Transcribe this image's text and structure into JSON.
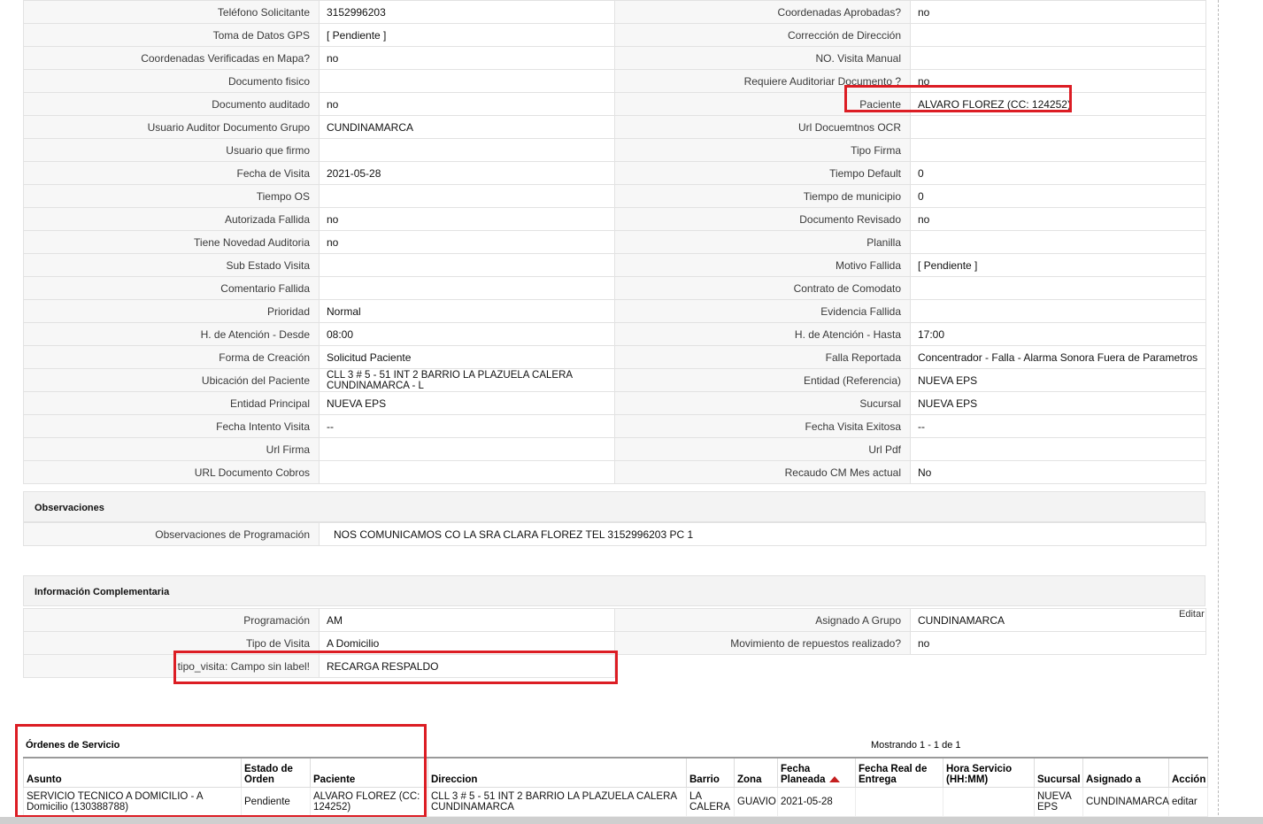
{
  "detail_rows": [
    [
      {
        "label": "Teléfono Solicitante",
        "value": "3152996203"
      },
      {
        "label": "Coordenadas Aprobadas?",
        "value": "no"
      }
    ],
    [
      {
        "label": "Toma de Datos GPS",
        "value": "[ Pendiente ]"
      },
      {
        "label": "Corrección de Dirección",
        "value": ""
      }
    ],
    [
      {
        "label": "Coordenadas Verificadas en Mapa?",
        "value": "no"
      },
      {
        "label": "NO. Visita Manual",
        "value": ""
      }
    ],
    [
      {
        "label": "Documento fisico",
        "value": ""
      },
      {
        "label": "Requiere Auditoriar Documento ?",
        "value": "no"
      }
    ],
    [
      {
        "label": "Documento auditado",
        "value": "no"
      },
      {
        "label": "Paciente",
        "value": "ALVARO FLOREZ (CC: 124252)"
      }
    ],
    [
      {
        "label": "Usuario Auditor Documento Grupo",
        "value": "CUNDINAMARCA"
      },
      {
        "label": "Url Docuemtnos OCR",
        "value": ""
      }
    ],
    [
      {
        "label": "Usuario que firmo",
        "value": ""
      },
      {
        "label": "Tipo Firma",
        "value": ""
      }
    ],
    [
      {
        "label": "Fecha de Visita",
        "value": "2021-05-28"
      },
      {
        "label": "Tiempo Default",
        "value": "0"
      }
    ],
    [
      {
        "label": "Tiempo OS",
        "value": ""
      },
      {
        "label": "Tiempo de municipio",
        "value": "0"
      }
    ],
    [
      {
        "label": "Autorizada Fallida",
        "value": "no"
      },
      {
        "label": "Documento Revisado",
        "value": "no"
      }
    ],
    [
      {
        "label": "Tiene Novedad Auditoria",
        "value": "no"
      },
      {
        "label": "Planilla",
        "value": ""
      }
    ],
    [
      {
        "label": "Sub Estado Visita",
        "value": ""
      },
      {
        "label": "Motivo Fallida",
        "value": "[ Pendiente ]"
      }
    ],
    [
      {
        "label": "Comentario Fallida",
        "value": ""
      },
      {
        "label": "Contrato de Comodato",
        "value": ""
      }
    ],
    [
      {
        "label": "Prioridad",
        "value": "Normal"
      },
      {
        "label": "Evidencia Fallida",
        "value": ""
      }
    ],
    [
      {
        "label": "H. de Atención - Desde",
        "value": "08:00"
      },
      {
        "label": "H. de Atención - Hasta",
        "value": "17:00"
      }
    ],
    [
      {
        "label": "Forma de Creación",
        "value": "Solicitud Paciente"
      },
      {
        "label": "Falla Reportada",
        "value": "Concentrador - Falla - Alarma Sonora Fuera de Parametros"
      }
    ],
    [
      {
        "label": "Ubicación del Paciente",
        "value": "CLL 3 # 5 - 51 INT 2 BARRIO LA PLAZUELA CALERA CUNDINAMARCA - L"
      },
      {
        "label": "Entidad (Referencia)",
        "value": "NUEVA EPS"
      }
    ],
    [
      {
        "label": "Entidad Principal",
        "value": "NUEVA EPS"
      },
      {
        "label": "Sucursal",
        "value": "NUEVA EPS"
      }
    ],
    [
      {
        "label": "Fecha Intento Visita",
        "value": "--"
      },
      {
        "label": "Fecha Visita Exitosa",
        "value": "--"
      }
    ],
    [
      {
        "label": "Url Firma",
        "value": ""
      },
      {
        "label": "Url Pdf",
        "value": ""
      }
    ],
    [
      {
        "label": "URL Documento Cobros",
        "value": ""
      },
      {
        "label": "Recaudo CM Mes actual",
        "value": "No"
      }
    ]
  ],
  "observaciones": {
    "title": "Observaciones",
    "label": "Observaciones de Programación",
    "value": "NOS COMUNICAMOS CO LA SRA CLARA FLOREZ TEL 3152996203 PC 1"
  },
  "info_complementaria": {
    "title": "Información Complementaria",
    "edit_label": "Editar",
    "rows": [
      [
        {
          "label": "Programación",
          "value": "AM"
        },
        {
          "label": "Asignado A Grupo",
          "value": "CUNDINAMARCA"
        }
      ],
      [
        {
          "label": "Tipo de Visita",
          "value": "A Domicilio"
        },
        {
          "label": "Movimiento de repuestos realizado?",
          "value": "no"
        }
      ],
      [
        {
          "label": "tipo_visita: Campo sin label!",
          "value": "RECARGA RESPALDO"
        }
      ]
    ]
  },
  "ordenes": {
    "title": "Órdenes de Servicio",
    "showing": "Mostrando 1 - 1 de 1",
    "columns": [
      "Asunto",
      "Estado de Orden",
      "Paciente",
      "Direccion",
      "Barrio",
      "Zona",
      "Fecha Planeada",
      "Fecha Real de Entrega",
      "Hora Servicio (HH:MM)",
      "Sucursal",
      "Asignado a",
      "Acción"
    ],
    "rows": [
      [
        "SERVICIO TECNICO A DOMICILIO - A Domicilio (130388788)",
        "Pendiente",
        "ALVARO FLOREZ (CC: 124252)",
        "CLL 3 # 5 - 51 INT 2 BARRIO LA PLAZUELA CALERA CUNDINAMARCA",
        "LA CALERA",
        "GUAVIO",
        "2021-05-28",
        "",
        "",
        "NUEVA EPS",
        "CUNDINAMARCA",
        "editar"
      ]
    ]
  }
}
